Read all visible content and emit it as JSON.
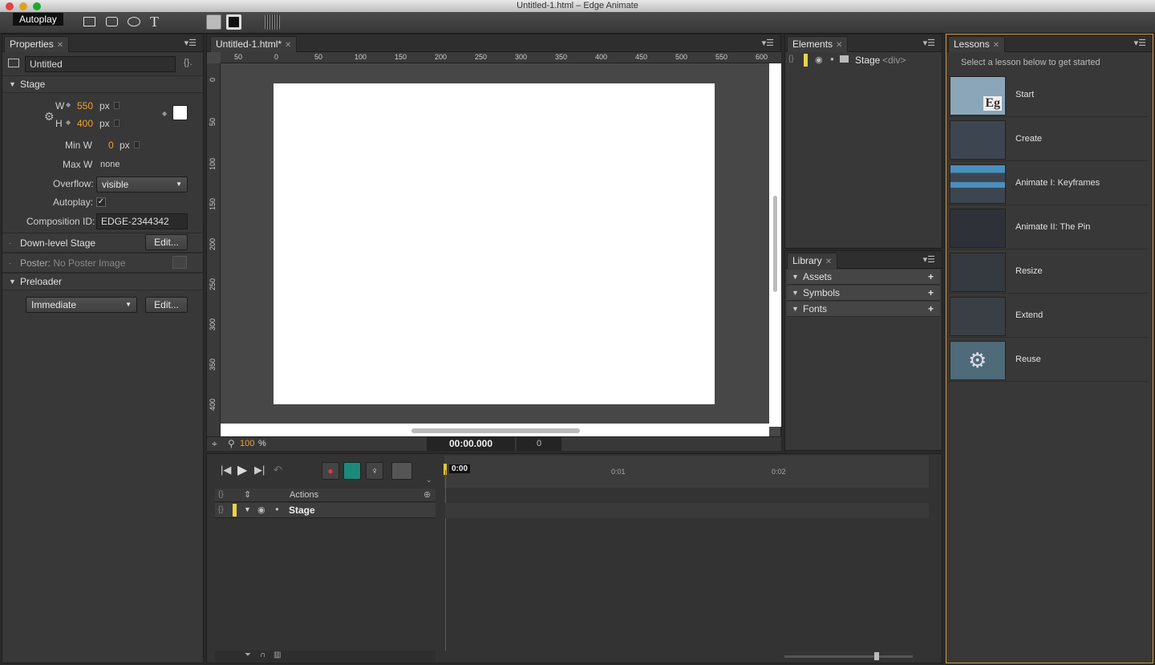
{
  "window": {
    "title": "Untitled-1.html – Edge Animate"
  },
  "toolbar": {
    "tooltip": "Autoplay"
  },
  "properties": {
    "tab": "Properties",
    "name_value": "Untitled",
    "stage_section": "Stage",
    "w_label": "W",
    "w_value": "550",
    "w_unit": "px",
    "h_label": "H",
    "h_value": "400",
    "h_unit": "px",
    "minw_label": "Min W",
    "minw_value": "0",
    "minw_unit": "px",
    "maxw_label": "Max W",
    "maxw_value": "none",
    "overflow_label": "Overflow:",
    "overflow_value": "visible",
    "autoplay_label": "Autoplay:",
    "autoplay_checked": "✓",
    "compid_label": "Composition ID:",
    "compid_value": "EDGE-2344342",
    "downlevel_label": "Down-level Stage",
    "downlevel_btn": "Edit...",
    "poster_label": "Poster:",
    "poster_value": "No Poster Image",
    "preloader_section": "Preloader",
    "preloader_value": "Immediate",
    "preloader_btn": "Edit..."
  },
  "stage": {
    "tab": "Untitled-1.html*",
    "hruler": [
      "50",
      "0",
      "50",
      "100",
      "150",
      "200",
      "250",
      "300",
      "350",
      "400",
      "450",
      "500",
      "550",
      "600"
    ],
    "vruler": [
      "0",
      "50",
      "100",
      "150",
      "200",
      "250",
      "300",
      "350",
      "400",
      "50"
    ],
    "zoom": "100",
    "zoom_unit": "%",
    "time": "00:00.000",
    "frame": "0"
  },
  "elements": {
    "tab": "Elements",
    "item_name": "Stage",
    "item_tag": "<div>"
  },
  "library": {
    "tab": "Library",
    "sections": [
      "Assets",
      "Symbols",
      "Fonts"
    ]
  },
  "lessons": {
    "tab": "Lessons",
    "intro": "Select a lesson below to get started",
    "items": [
      "Start",
      "Create",
      "Animate I: Keyframes",
      "Animate II: The Pin",
      "Resize",
      "Extend",
      "Reuse"
    ]
  },
  "timeline": {
    "playhead": "0:00",
    "marks": [
      "0:01",
      "0:02"
    ],
    "actions_label": "Actions",
    "stage_label": "Stage"
  }
}
